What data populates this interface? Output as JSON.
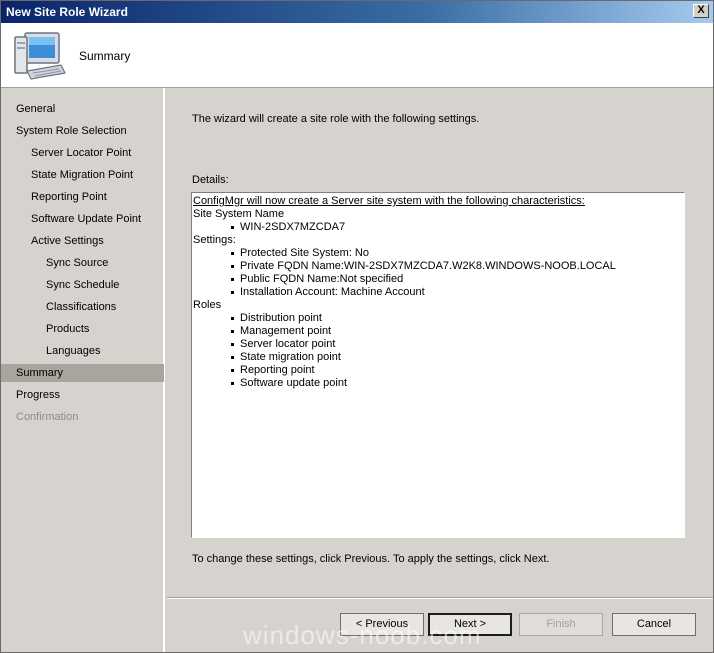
{
  "window": {
    "title": "New Site Role Wizard",
    "close_label": "X"
  },
  "header": {
    "title": "Summary",
    "icon": "computer-icon"
  },
  "nav": {
    "items": [
      {
        "label": "General",
        "indent": 0,
        "state": "normal"
      },
      {
        "label": "System Role Selection",
        "indent": 0,
        "state": "normal"
      },
      {
        "label": "Server Locator Point",
        "indent": 1,
        "state": "normal"
      },
      {
        "label": "State Migration Point",
        "indent": 1,
        "state": "normal"
      },
      {
        "label": "Reporting Point",
        "indent": 1,
        "state": "normal"
      },
      {
        "label": "Software Update Point",
        "indent": 1,
        "state": "normal"
      },
      {
        "label": "Active Settings",
        "indent": 1,
        "state": "normal"
      },
      {
        "label": "Sync Source",
        "indent": 2,
        "state": "normal"
      },
      {
        "label": "Sync Schedule",
        "indent": 2,
        "state": "normal"
      },
      {
        "label": "Classifications",
        "indent": 2,
        "state": "normal"
      },
      {
        "label": "Products",
        "indent": 2,
        "state": "normal"
      },
      {
        "label": "Languages",
        "indent": 2,
        "state": "normal"
      },
      {
        "label": "Summary",
        "indent": 0,
        "state": "active"
      },
      {
        "label": "Progress",
        "indent": 0,
        "state": "normal"
      },
      {
        "label": "Confirmation",
        "indent": 0,
        "state": "disabled"
      }
    ]
  },
  "main": {
    "intro": "The wizard will create a site role with the following settings.",
    "details_label": "Details:",
    "details": {
      "header": "ConfigMgr will now create a Server site system with the following characteristics:",
      "sections": [
        {
          "title": "Site System Name",
          "items": [
            "WIN-2SDX7MZCDA7"
          ]
        },
        {
          "title": "Settings:",
          "items": [
            "Protected Site System: No",
            "Private FQDN Name:WIN-2SDX7MZCDA7.W2K8.WINDOWS-NOOB.LOCAL",
            "Public FQDN Name:Not specified",
            "Installation Account: Machine Account"
          ]
        },
        {
          "title": "Roles",
          "items": [
            "Distribution point",
            "Management point",
            "Server locator point",
            "State migration point",
            "Reporting point",
            "Software update point"
          ]
        }
      ]
    },
    "footer_text": "To change these settings, click Previous. To apply the settings, click Next."
  },
  "buttons": {
    "previous": "< Previous",
    "next": "Next >",
    "finish": "Finish",
    "cancel": "Cancel"
  },
  "watermark": "windows-noob.com"
}
